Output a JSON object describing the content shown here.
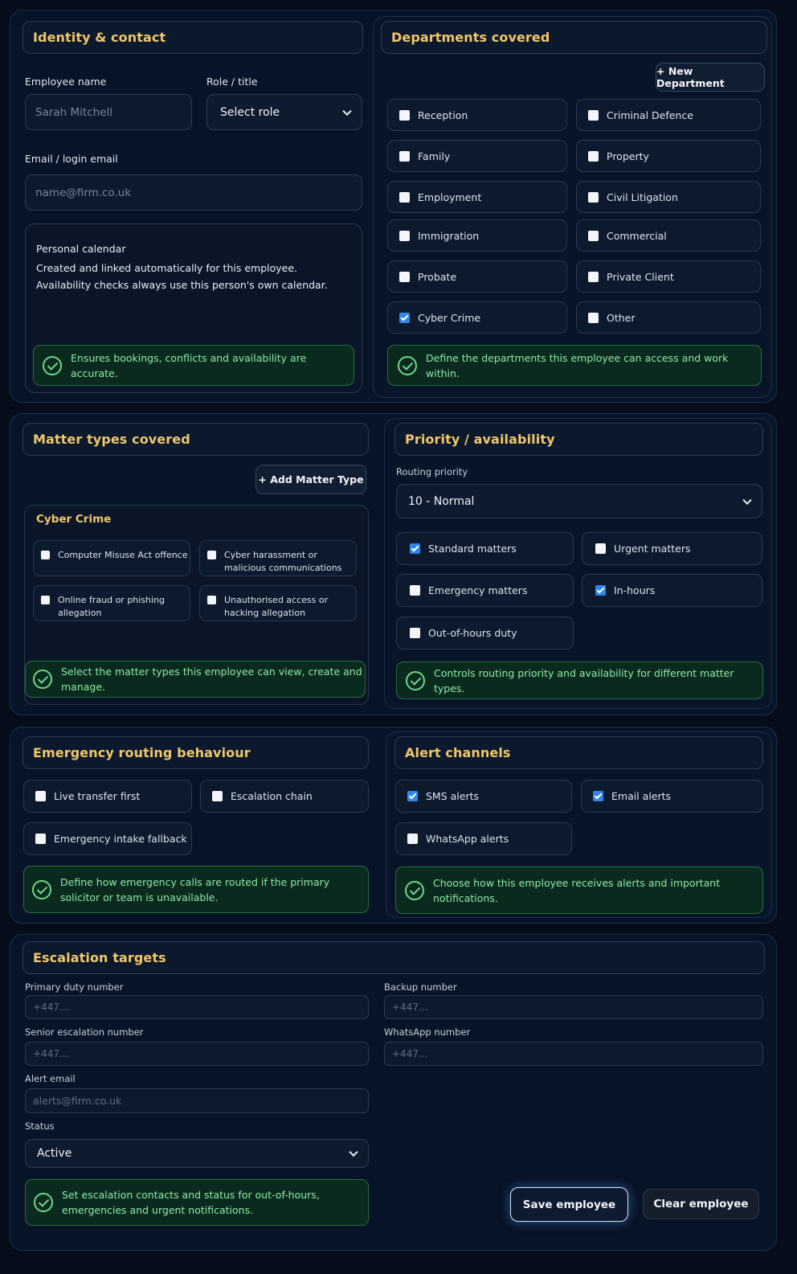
{
  "identity": {
    "title": "Identity & contact",
    "name_label": "Employee name",
    "name_placeholder": "Sarah Mitchell",
    "role_label": "Role / title",
    "role_value": "Select role",
    "email_label": "Email / login email",
    "email_placeholder": "name@firm.co.uk",
    "calendar_title": "Personal calendar",
    "calendar_line1": "Created and linked automatically for this employee.",
    "calendar_line2": "Availability checks always use this person's own calendar.",
    "note": "Ensures bookings, conflicts and availability are accurate."
  },
  "departments": {
    "title": "Departments covered",
    "new_button": "+ New Department",
    "items": [
      {
        "label": "Reception",
        "checked": false
      },
      {
        "label": "Criminal Defence",
        "checked": false
      },
      {
        "label": "Family",
        "checked": false
      },
      {
        "label": "Property",
        "checked": false
      },
      {
        "label": "Employment",
        "checked": false
      },
      {
        "label": "Civil Litigation",
        "checked": false
      },
      {
        "label": "Immigration",
        "checked": false
      },
      {
        "label": "Commercial",
        "checked": false
      },
      {
        "label": "Probate",
        "checked": false
      },
      {
        "label": "Private Client",
        "checked": false
      },
      {
        "label": "Cyber Crime",
        "checked": true
      },
      {
        "label": "Other",
        "checked": false
      }
    ],
    "note": "Define the departments this employee can access and work within."
  },
  "matter_types": {
    "title": "Matter types covered",
    "add_button": "+ Add Matter Type",
    "group_title": "Cyber Crime",
    "items": [
      {
        "label": "Computer Misuse Act offence",
        "checked": false
      },
      {
        "label": "Cyber harassment or malicious communications",
        "checked": false
      },
      {
        "label": "Online fraud or phishing allegation",
        "checked": false
      },
      {
        "label": "Unauthorised access or hacking allegation",
        "checked": false
      }
    ],
    "note": "Select the matter types this employee can view, create and manage."
  },
  "priority": {
    "title": "Priority / availability",
    "routing_label": "Routing priority",
    "routing_value": "10 - Normal",
    "items": [
      {
        "label": "Standard matters",
        "checked": true
      },
      {
        "label": "Urgent matters",
        "checked": false
      },
      {
        "label": "Emergency matters",
        "checked": false
      },
      {
        "label": "In-hours",
        "checked": true
      },
      {
        "label": "Out-of-hours duty",
        "checked": false
      }
    ],
    "note": "Controls routing priority and availability for different matter types."
  },
  "emergency": {
    "title": "Emergency routing behaviour",
    "items": [
      {
        "label": "Live transfer first",
        "checked": false
      },
      {
        "label": "Escalation chain",
        "checked": false
      },
      {
        "label": "Emergency intake fallback",
        "checked": false
      }
    ],
    "note_line1": "Define how emergency calls are routed if the primary",
    "note_line2": "solicitor or team is unavailable."
  },
  "alerts": {
    "title": "Alert channels",
    "items": [
      {
        "label": "SMS alerts",
        "checked": true
      },
      {
        "label": "Email alerts",
        "checked": true
      },
      {
        "label": "WhatsApp alerts",
        "checked": false
      }
    ],
    "note_line1": "Choose how this employee receives alerts and important",
    "note_line2": "notifications."
  },
  "escalation": {
    "title": "Escalation targets",
    "primary_label": "Primary duty number",
    "primary_placeholder": "+447...",
    "backup_label": "Backup number",
    "backup_placeholder": "+447...",
    "senior_label": "Senior escalation number",
    "senior_placeholder": "+447...",
    "whatsapp_label": "WhatsApp number",
    "whatsapp_placeholder": "+447...",
    "alert_email_label": "Alert email",
    "alert_email_placeholder": "alerts@firm.co.uk",
    "status_label": "Status",
    "status_value": "Active",
    "note_line1": "Set escalation contacts and status for out-of-hours,",
    "note_line2": "emergencies and urgent notifications.",
    "save_button": "Save employee",
    "clear_button": "Clear employee"
  }
}
